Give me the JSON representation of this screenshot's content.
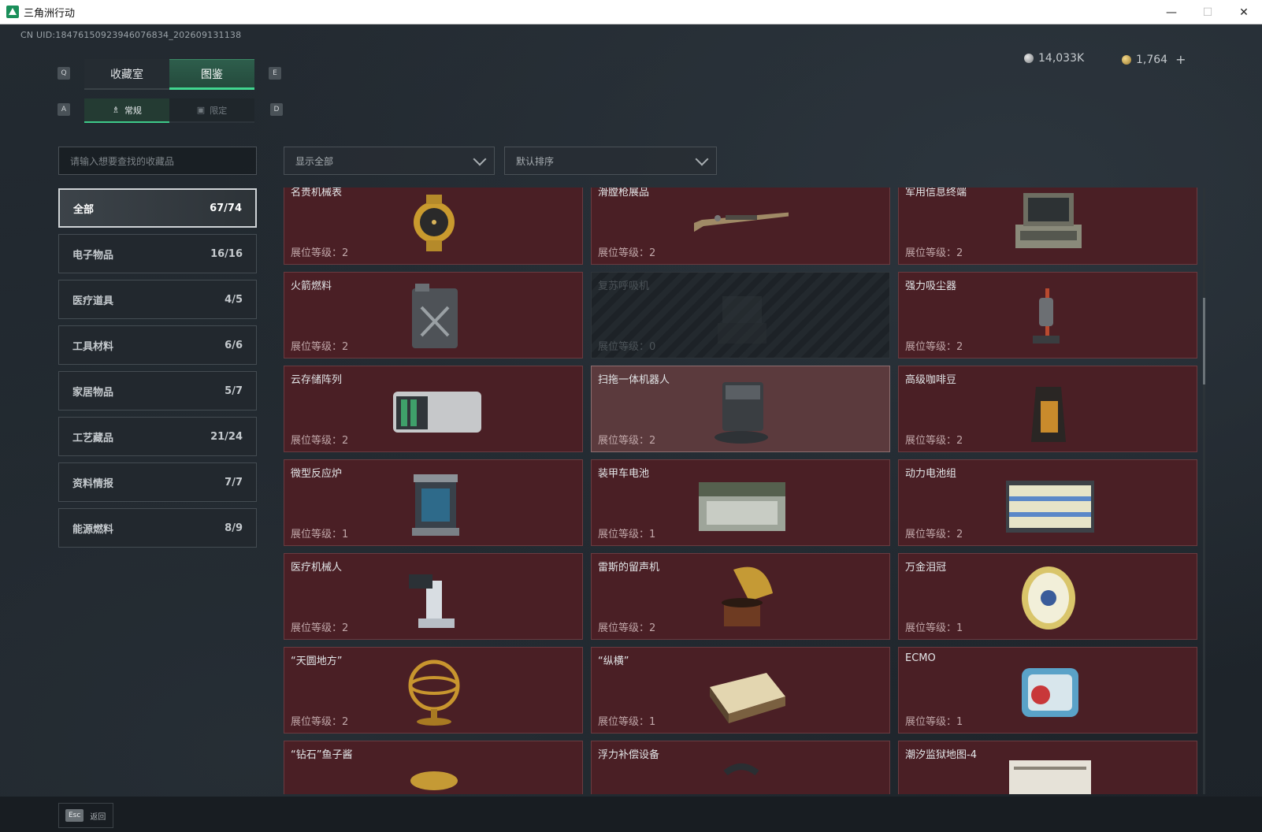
{
  "window": {
    "title": "三角洲行动",
    "minimize": "—",
    "maximize": "☐",
    "close": "✕"
  },
  "header": {
    "uid": "CN UID:18476150923946076834_202609131138",
    "currency_silver": "14,033K",
    "currency_gold": "1,764",
    "plus": "+"
  },
  "keys": {
    "q": "Q",
    "e": "E",
    "a": "A",
    "d": "D"
  },
  "main_tabs": [
    {
      "label": "收藏室"
    },
    {
      "label": "图鉴"
    }
  ],
  "sub_tabs": [
    {
      "label": "常规",
      "glyph": "♗"
    },
    {
      "label": "限定",
      "glyph": "▣"
    }
  ],
  "search": {
    "placeholder": "请输入想要查找的收藏品"
  },
  "filter": {
    "selected": "显示全部"
  },
  "sort": {
    "selected": "默认排序"
  },
  "categories": [
    {
      "label": "全部",
      "count": "67/74"
    },
    {
      "label": "电子物品",
      "count": "16/16"
    },
    {
      "label": "医疗道具",
      "count": "4/5"
    },
    {
      "label": "工具材料",
      "count": "6/6"
    },
    {
      "label": "家居物品",
      "count": "5/7"
    },
    {
      "label": "工艺藏品",
      "count": "21/24"
    },
    {
      "label": "资料情报",
      "count": "7/7"
    },
    {
      "label": "能源燃料",
      "count": "8/9"
    }
  ],
  "items": [
    {
      "name": "名贵机械表",
      "level": "展位等级：2",
      "icon": "watch-icon"
    },
    {
      "name": "滑膛枪展品",
      "level": "展位等级：2",
      "icon": "musket-icon"
    },
    {
      "name": "军用信息终端",
      "level": "展位等级：2",
      "icon": "terminal-icon"
    },
    {
      "name": "火箭燃料",
      "level": "展位等级：2",
      "icon": "fuel-can-icon"
    },
    {
      "name": "复苏呼吸机",
      "level": "展位等级：0",
      "icon": "ventilator-icon"
    },
    {
      "name": "强力吸尘器",
      "level": "展位等级：2",
      "icon": "vacuum-icon"
    },
    {
      "name": "云存储阵列",
      "level": "展位等级：2",
      "icon": "storage-array-icon"
    },
    {
      "name": "扫拖一体机器人",
      "level": "展位等级：2",
      "icon": "mop-robot-icon"
    },
    {
      "name": "高级咖啡豆",
      "level": "展位等级：2",
      "icon": "coffee-bag-icon"
    },
    {
      "name": "微型反应炉",
      "level": "展位等级：1",
      "icon": "reactor-icon"
    },
    {
      "name": "装甲车电池",
      "level": "展位等级：1",
      "icon": "battery-icon"
    },
    {
      "name": "动力电池组",
      "level": "展位等级：2",
      "icon": "battery-pack-icon"
    },
    {
      "name": "医疗机械人",
      "level": "展位等级：2",
      "icon": "medical-robot-icon"
    },
    {
      "name": "雷斯的留声机",
      "level": "展位等级：2",
      "icon": "gramophone-icon"
    },
    {
      "name": "万金泪冠",
      "level": "展位等级：1",
      "icon": "jeweled-egg-icon"
    },
    {
      "name": "“天圆地方”",
      "level": "展位等级：2",
      "icon": "armillary-icon"
    },
    {
      "name": "“纵横”",
      "level": "展位等级：1",
      "icon": "chess-icon"
    },
    {
      "name": "ECMO",
      "level": "展位等级：1",
      "icon": "ecmo-icon"
    },
    {
      "name": "“钻石”鱼子酱",
      "level": "",
      "icon": "caviar-icon"
    },
    {
      "name": "浮力补偿设备",
      "level": "",
      "icon": "bcd-icon"
    },
    {
      "name": "潮汐监狱地图-4",
      "level": "",
      "icon": "map-icon"
    }
  ],
  "footer": {
    "esc_key": "Esc",
    "back_label": "返回"
  }
}
